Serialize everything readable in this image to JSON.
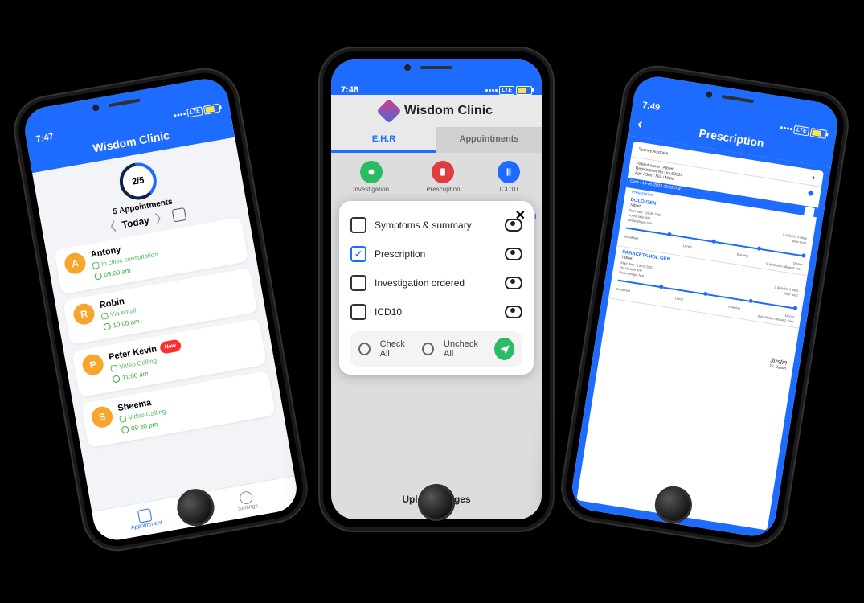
{
  "phone1": {
    "status_time": "7:47",
    "lte": "LTE",
    "title": "Wisdom Clinic",
    "counter": "2/5",
    "appt_count_label": "5 Appointments",
    "day_label": "Today",
    "appointments": [
      {
        "initial": "A",
        "name": "Antony",
        "mode": "In clinic consultation",
        "time": "09:00 am",
        "new": false
      },
      {
        "initial": "R",
        "name": "Robin",
        "mode": "Via email",
        "time": "10:00 am",
        "new": false
      },
      {
        "initial": "P",
        "name": "Peter Kevin",
        "mode": "Video Calling",
        "time": "11:00 am",
        "new": true
      },
      {
        "initial": "S",
        "name": "Sheema",
        "mode": "Video Calling",
        "time": "09:30 pm",
        "new": false
      }
    ],
    "new_badge": "New",
    "tab_appointment": "Appointment",
    "tab_settings": "Settings"
  },
  "phone2": {
    "status_time": "7:48",
    "lte": "LTE",
    "title": "Wisdom Clinic",
    "tab_ehr": "E.H.R",
    "tab_appts": "Appointments",
    "chip_investigation": "Investigation",
    "chip_prescription": "Prescription",
    "chip_icd10": "ICD10",
    "edit_label": "it",
    "modal": {
      "options": [
        {
          "label": "Symptoms & summary",
          "checked": false
        },
        {
          "label": "Prescription",
          "checked": true
        },
        {
          "label": "Investigation ordered",
          "checked": false
        },
        {
          "label": "ICD10",
          "checked": false
        }
      ],
      "check_all": "Check All",
      "uncheck_all": "Uncheck All"
    },
    "upload_label": "Upload images"
  },
  "phone3": {
    "status_time": "7:49",
    "lte": "LTE",
    "title": "Prescription",
    "clinic_loc": "Sydney,Australia",
    "patient_name_label": "Patient name",
    "patient_name": "Albert",
    "reg_label": "Registration No",
    "reg": "Inv00024",
    "age_label": "Age / Sex",
    "age": "N/A / Male",
    "date_label": "Date : 19-05-2023 05:52 PM",
    "section": "Prescription",
    "drugs": [
      {
        "name": "DOLO GEN",
        "form": "Tablet",
        "start": "Start date : 19-05-2023",
        "intake": "Hourly take        4/H",
        "dshape": "Doctor'shape        N/A",
        "dose": "2 daily for 3 days",
        "after": "After food",
        "sub": "Substitution allowed : Yes",
        "slots": [
          "Breakfast",
          "Lunch",
          "Evening",
          "Dinner"
        ]
      },
      {
        "name": "PARACETAMOL GEN",
        "form": "Tablet",
        "start": "Start date : 19-05-2023",
        "intake": "Hourly take        4/H",
        "dshape": "Doctor'shape        N/A",
        "dose": "2 daily for 3 days",
        "after": "After food",
        "sub": "Substitution allowed : Yes",
        "slots": [
          "Breakfast",
          "Lunch",
          "Evening",
          "Dinner"
        ]
      }
    ],
    "doctor": "Dr. Justin"
  }
}
